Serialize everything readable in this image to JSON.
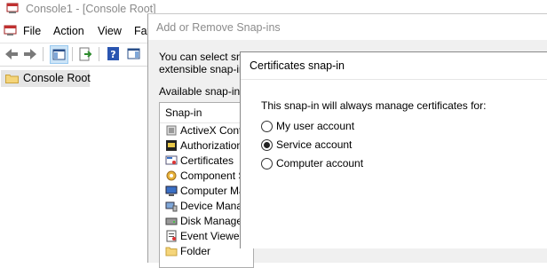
{
  "main_window": {
    "title": "Console1 - [Console Root]",
    "menu": [
      "File",
      "Action",
      "View",
      "Fav"
    ],
    "tree": {
      "root_label": "Console Root"
    }
  },
  "add_remove_dialog": {
    "title": "Add or Remove Snap-ins",
    "description_line1": "You can select snap",
    "description_line2": "extensible snap-ins",
    "available_label": "Available snap-ins:",
    "column_header": "Snap-in",
    "snapins": [
      {
        "label": "ActiveX Control",
        "icon": "activex-icon"
      },
      {
        "label": "Authorization M",
        "icon": "authorization-icon"
      },
      {
        "label": "Certificates",
        "icon": "certificates-icon"
      },
      {
        "label": "Component Se",
        "icon": "component-services-icon"
      },
      {
        "label": "Computer Man",
        "icon": "computer-management-icon"
      },
      {
        "label": "Device Manage",
        "icon": "device-manager-icon"
      },
      {
        "label": "Disk Manageme",
        "icon": "disk-management-icon"
      },
      {
        "label": "Event Viewer",
        "icon": "event-viewer-icon"
      },
      {
        "label": "Folder",
        "icon": "folder-icon"
      }
    ]
  },
  "certificates_dialog": {
    "title": "Certificates snap-in",
    "instruction": "This snap-in will always manage certificates for:",
    "options": [
      {
        "label": "My user account",
        "selected": false
      },
      {
        "label": "Service account",
        "selected": true
      },
      {
        "label": "Computer account",
        "selected": false
      }
    ]
  },
  "colors": {
    "selection_gray": "#e5e5e5",
    "dialog_bg": "#f0f0f0",
    "dim_title": "#8a8a8a"
  }
}
